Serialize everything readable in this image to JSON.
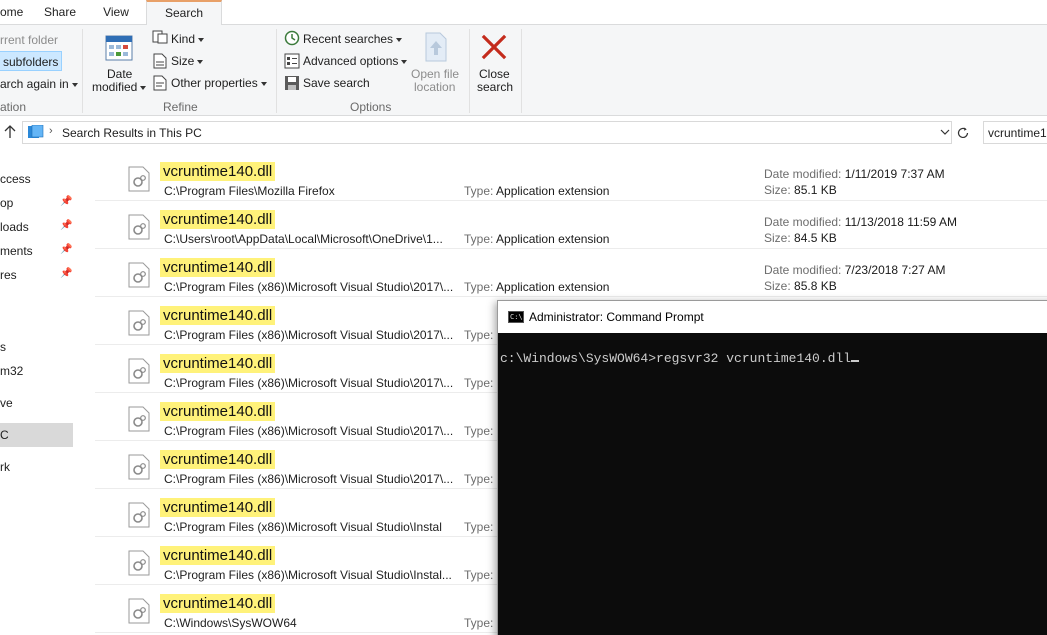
{
  "ribbon_tabs": [
    {
      "label": "ome"
    },
    {
      "label": "Share"
    },
    {
      "label": "View"
    },
    {
      "label": "Search"
    }
  ],
  "ribbon": {
    "location": {
      "current_folder": "rrent folder",
      "subfolders": "subfolders",
      "search_again": "arch again in",
      "group_label": "ation"
    },
    "refine": {
      "date_modified_line1": "Date",
      "date_modified_line2": "modified",
      "kind": "Kind",
      "size": "Size",
      "other_properties": "Other properties",
      "group_label": "Refine"
    },
    "options": {
      "recent_searches": "Recent searches",
      "advanced_options": "Advanced options",
      "save_search": "Save search",
      "open_file_location_line1": "Open file",
      "open_file_location_line2": "location",
      "group_label": "Options"
    },
    "close": {
      "line1": "Close",
      "line2": "search"
    }
  },
  "address": {
    "path": "Search Results in This PC",
    "search_value": "vcruntime1"
  },
  "nav": {
    "items": [
      {
        "label": "ccess",
        "pinned": false
      },
      {
        "label": "op",
        "pinned": true
      },
      {
        "label": "loads",
        "pinned": true
      },
      {
        "label": "ments",
        "pinned": true
      },
      {
        "label": "res",
        "pinned": true
      },
      {
        "label": "s",
        "pinned": false
      },
      {
        "label": "m32",
        "pinned": false
      },
      {
        "label": "ve",
        "pinned": false
      },
      {
        "label": "C",
        "pinned": false
      },
      {
        "label": "rk",
        "pinned": false
      }
    ]
  },
  "results": {
    "type_label": "Type:",
    "date_label": "Date modified:",
    "size_label": "Size:",
    "rows": [
      {
        "name": "vcruntime140.dll",
        "path": "C:\\Program Files\\Mozilla Firefox",
        "type": "Application extension",
        "date": "1/11/2019 7:37 AM",
        "size": "85.1 KB"
      },
      {
        "name": "vcruntime140.dll",
        "path": "C:\\Users\\root\\AppData\\Local\\Microsoft\\OneDrive\\1...",
        "type": "Application extension",
        "date": "11/13/2018 11:59 AM",
        "size": "84.5 KB"
      },
      {
        "name": "vcruntime140.dll",
        "path": "C:\\Program Files (x86)\\Microsoft Visual Studio\\2017\\...",
        "type": "Application extension",
        "date": "7/23/2018 7:27 AM",
        "size": "85.8 KB"
      },
      {
        "name": "vcruntime140.dll",
        "path": "C:\\Program Files (x86)\\Microsoft Visual Studio\\2017\\..."
      },
      {
        "name": "vcruntime140.dll",
        "path": "C:\\Program Files (x86)\\Microsoft Visual Studio\\2017\\..."
      },
      {
        "name": "vcruntime140.dll",
        "path": "C:\\Program Files (x86)\\Microsoft Visual Studio\\2017\\..."
      },
      {
        "name": "vcruntime140.dll",
        "path": "C:\\Program Files (x86)\\Microsoft Visual Studio\\2017\\..."
      },
      {
        "name": "vcruntime140.dll",
        "path": "C:\\Program Files (x86)\\Microsoft Visual Studio\\Instal"
      },
      {
        "name": "vcruntime140.dll",
        "path": "C:\\Program Files (x86)\\Microsoft Visual Studio\\Instal..."
      },
      {
        "name": "vcruntime140.dll",
        "path": "C:\\Windows\\SysWOW64"
      }
    ]
  },
  "cmd": {
    "title": "Administrator: Command Prompt",
    "icon_text": "C:\\",
    "line": "c:\\Windows\\SysWOW64>regsvr32 vcruntime140.dll"
  },
  "colors": {
    "highlight": "#fff27a",
    "ribbon_bg": "#f5f6f7",
    "selected_button": "#cce8ff",
    "close_red": "#c42b1c",
    "console_bg": "#0c0c0c"
  }
}
